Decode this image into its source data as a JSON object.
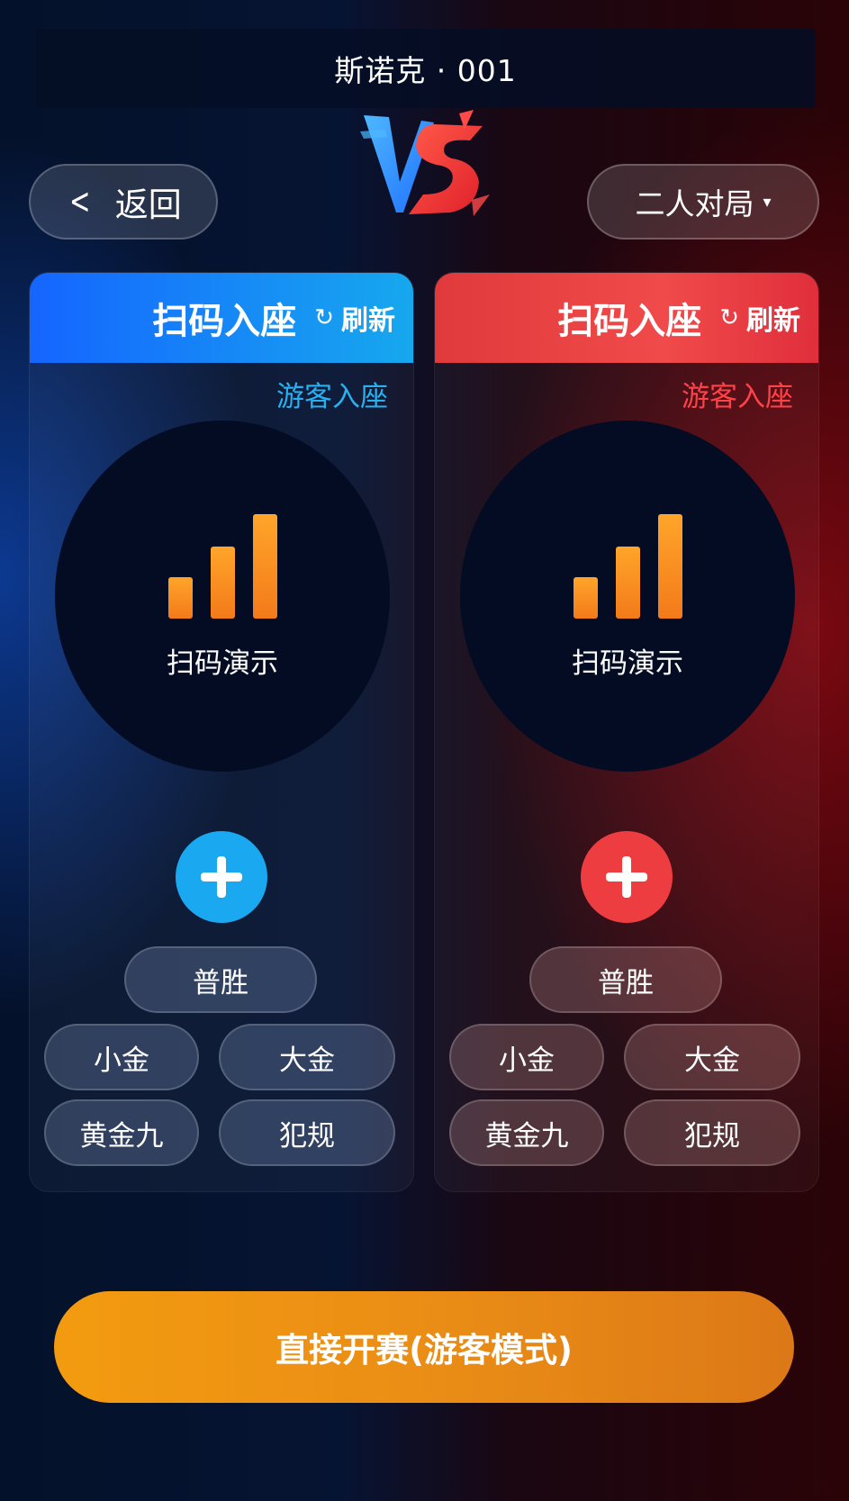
{
  "header": {
    "title": "斯诺克 · 001",
    "back_label": "返回",
    "back_icon": "chevron-left-icon",
    "mode_label": "二人对局",
    "mode_caret": "▾",
    "vs_logo": "VS"
  },
  "colors": {
    "left_accent": "#1aa9f0",
    "right_accent": "#ee3d40",
    "bar_orange": "#f37a1a",
    "start_orange": "#f39b10"
  },
  "left_panel": {
    "title": "扫码入座",
    "refresh_icon": "↻",
    "refresh_label": "刷新",
    "guest_label": "游客入座",
    "demo_label": "扫码演示",
    "add_icon": "plus-icon",
    "buttons": {
      "main": "普胜",
      "b1": "小金",
      "b2": "大金",
      "b3": "黄金九",
      "b4": "犯规"
    }
  },
  "right_panel": {
    "title": "扫码入座",
    "refresh_icon": "↻",
    "refresh_label": "刷新",
    "guest_label": "游客入座",
    "demo_label": "扫码演示",
    "add_icon": "plus-icon",
    "buttons": {
      "main": "普胜",
      "b1": "小金",
      "b2": "大金",
      "b3": "黄金九",
      "b4": "犯规"
    }
  },
  "footer": {
    "start_label": "直接开赛(游客模式)"
  }
}
